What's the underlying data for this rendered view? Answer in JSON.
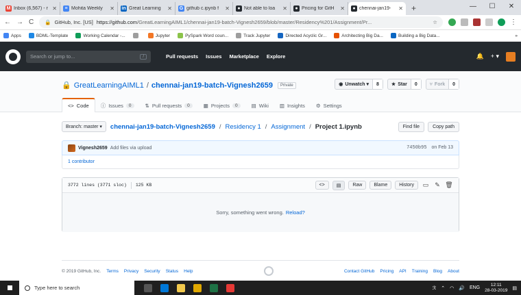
{
  "browser": {
    "tabs": [
      {
        "label": "Inbox (6,567) - r",
        "icon_color": "#ea4335",
        "icon_char": "M",
        "active": false
      },
      {
        "label": "Mohita Weekly",
        "icon_color": "#4285f4",
        "icon_char": "≡",
        "active": false
      },
      {
        "label": "Great Learning",
        "icon_color": "#0a66c2",
        "icon_char": "in",
        "active": false
      },
      {
        "label": "github c.ipynb f",
        "icon_color": "#4285f4",
        "icon_char": "G",
        "active": false
      },
      {
        "label": "Not able to loa",
        "icon_color": "#24292e",
        "icon_char": "●",
        "active": false
      },
      {
        "label": "Pricing for GitH",
        "icon_color": "#24292e",
        "icon_char": "●",
        "active": false
      },
      {
        "label": "chennai-jan19-",
        "icon_color": "#24292e",
        "icon_char": "●",
        "active": true
      }
    ],
    "new_tab": "+",
    "window_controls": [
      "—",
      "☐",
      "✕"
    ],
    "nav": {
      "back": "←",
      "forward": "→",
      "reload": "C"
    },
    "address": {
      "secure_label": "GitHub, Inc. [US]",
      "url_host": "https://github.com",
      "url_path": "/GreatLearningAIML1/chennai-jan19-batch-Vignesh2659/blob/master/Residency%201/Assignment/Pr..."
    },
    "menu": "⋮",
    "bookmarks": [
      {
        "label": "Apps",
        "color": "#4285f4"
      },
      {
        "label": "BDML-Template",
        "color": "#1e88e5"
      },
      {
        "label": "Working Calendar -...",
        "color": "#0f9d58"
      },
      {
        "label": "",
        "color": "#9e9e9e"
      },
      {
        "label": "Jupyter",
        "color": "#f37726"
      },
      {
        "label": "PySpark Word coun...",
        "color": "#8bc34a"
      },
      {
        "label": "Track Jupyter",
        "color": "#9e9e9e"
      },
      {
        "label": "Directed Acyclic Gr...",
        "color": "#1565c0"
      },
      {
        "label": "Architecting Big Da...",
        "color": "#e65100"
      },
      {
        "label": "Building a Big Data...",
        "color": "#0a66c2"
      }
    ],
    "bookmarks_more": "»"
  },
  "github_header": {
    "search_placeholder": "Search or jump to...",
    "search_key": "/",
    "nav": [
      "Pull requests",
      "Issues",
      "Marketplace",
      "Explore"
    ],
    "plus": "+ ▾"
  },
  "repo": {
    "owner": "GreatLearningAIML1",
    "separator": "/",
    "name": "chennai-jan19-batch-Vignesh2659",
    "visibility": "Private",
    "watch": {
      "label": "Unwatch ▾",
      "count": "8"
    },
    "star": {
      "label": "Star",
      "count": "0"
    },
    "fork": {
      "label": "Fork",
      "count": "0"
    },
    "tabs": [
      {
        "label": "Code",
        "icon": "<>",
        "count": null,
        "selected": true
      },
      {
        "label": "Issues",
        "icon": "ⓘ",
        "count": "0",
        "selected": false
      },
      {
        "label": "Pull requests",
        "icon": "⇅",
        "count": "0",
        "selected": false
      },
      {
        "label": "Projects",
        "icon": "▦",
        "count": "0",
        "selected": false
      },
      {
        "label": "Wiki",
        "icon": "▤",
        "count": null,
        "selected": false
      },
      {
        "label": "Insights",
        "icon": "▥",
        "count": null,
        "selected": false
      },
      {
        "label": "Settings",
        "icon": "⚙",
        "count": null,
        "selected": false
      }
    ]
  },
  "breadcrumb": {
    "branch": "Branch: master ▾",
    "repo": "chennai-jan19-batch-Vignesh2659",
    "dir1": "Residency 1",
    "dir2": "Assignment",
    "file": "Project 1.ipynb",
    "sep": "/",
    "find_file": "Find file",
    "copy_path": "Copy path"
  },
  "commit": {
    "author": "Vignesh2659",
    "message": "Add files via upload",
    "sha": "7450b95",
    "date": "on Feb 13",
    "contributors": "1 contributor"
  },
  "file": {
    "lines": "3772 lines (3771 sloc)",
    "size": "125 KB",
    "raw": "Raw",
    "blame": "Blame",
    "history": "History",
    "error_text": "Sorry, something went wrong.",
    "reload": "Reload?"
  },
  "footer": {
    "copyright": "© 2019 GitHub, Inc.",
    "left_links": [
      "Terms",
      "Privacy",
      "Security",
      "Status",
      "Help"
    ],
    "right_links": [
      "Contact GitHub",
      "Pricing",
      "API",
      "Training",
      "Blog",
      "About"
    ]
  },
  "taskbar": {
    "search": "Type here to search",
    "lang": "ENG",
    "time": "12:11",
    "date": "28-03-2019",
    "app_colors": [
      "#555555",
      "#0078d7",
      "#f2c94c",
      "#e0a800",
      "#1e7145",
      "#e53935"
    ]
  }
}
